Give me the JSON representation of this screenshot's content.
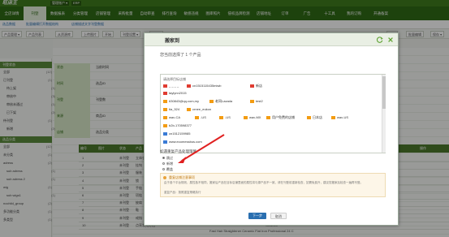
{
  "app": {
    "brand": "旺店王",
    "account": "管理账户 ▾",
    "erp": "ERP"
  },
  "nav": [
    "全店详情",
    "刊登",
    "数据报表",
    "分类管理",
    "店铺管理",
    "采购批量",
    "自动审查",
    "排行查询",
    "敏感违规",
    "图库照片",
    "侵权品牌检测",
    "店铺地址",
    "订单",
    "广告",
    "十工具",
    "我的订购",
    "开通备案"
  ],
  "subbar": [
    "选品数据",
    "批量编辑打开数据结构",
    "店铺描述文字刊登数据"
  ],
  "toolbar": [
    "产品管理 ▾",
    "产品列表",
    "从资源库",
    "上传图片",
    "开始",
    "刊登设置 ▾",
    "翻译 ▾",
    "配置",
    "批量编辑",
    "字段",
    "保存 ▾"
  ],
  "sidebar": {
    "sections": [
      {
        "label": "刊登状态",
        "count": "(1)",
        "items": [
          {
            "label": "全部",
            "count": "(12)"
          },
          {
            "label": "已刊登",
            "count": "(1)"
          },
          {
            "label": "待上架",
            "count": "(1)"
          },
          {
            "label": "审核中",
            "count": "(3)"
          },
          {
            "label": "审核未通过",
            "count": "(1)"
          },
          {
            "label": "已下架",
            "count": "(2)"
          },
          {
            "label": "待刊登",
            "count": "(1)"
          },
          {
            "label": "新增",
            "count": "(2)"
          }
        ]
      },
      {
        "label": "选品分类",
        "count": "(1)",
        "items": [
          {
            "label": "全部",
            "count": "(12)"
          },
          {
            "label": "未分类",
            "count": "(1)"
          },
          {
            "label": "adress",
            "count": "(2)"
          },
          {
            "label": "sub adress",
            "count": "(1)"
          },
          {
            "label": "sub adress 2",
            "count": "(1)"
          },
          {
            "label": "wig",
            "count": "(1)"
          },
          {
            "label": "sub wigs1",
            "count": "(1)"
          },
          {
            "label": "nochild_group",
            "count": "(2)"
          },
          {
            "label": "多功能分类",
            "count": "(1)"
          },
          {
            "label": "多类型",
            "count": "(1)"
          }
        ]
      }
    ]
  },
  "filter": {
    "left": [
      "状态",
      "时间",
      "刊登",
      "来源",
      "店铺",
      "品牌",
      "选购数量"
    ],
    "col1": [
      "当前时间",
      "选品ID",
      "刊登数",
      "商品ID",
      "选品分类",
      "刊登状态",
      "已刊登"
    ],
    "col2": [
      "选择ID",
      "选择SKU",
      "选择店铺",
      "选择产品",
      "选择分类",
      "选择状态",
      "选择刊登"
    ]
  },
  "table": {
    "headers": [
      "编号",
      "图片",
      "图像",
      "状态",
      "产品",
      "标题",
      "价格",
      "库存",
      "销量",
      "状态",
      "操作"
    ],
    "rows": [
      {
        "no": "1",
        "status": "未刊登",
        "title": "立体衣框",
        "sku": "SKU001"
      },
      {
        "no": "2",
        "status": "未刊登",
        "title": "挂钩",
        "sku": "SKU002"
      },
      {
        "no": "3",
        "status": "未刊登",
        "title": "服装",
        "sku": "SKU003"
      },
      {
        "no": "4",
        "status": "未刊登",
        "title": "锁",
        "sku": "SKU004"
      },
      {
        "no": "5",
        "status": "未刊登",
        "title": "手链",
        "sku": "SKU005"
      },
      {
        "no": "6",
        "status": "未刊登",
        "title": "项链",
        "sku": "SKU006"
      },
      {
        "no": "7",
        "status": "未刊登",
        "title": "披肩",
        "sku": "SKU007"
      },
      {
        "no": "8",
        "status": "未刊登",
        "title": "鞋",
        "sku": "SKU008"
      },
      {
        "no": "9",
        "status": "未刊登",
        "title": "戒指",
        "sku": "SKU009"
      },
      {
        "no": "10",
        "status": "未刊登",
        "title": "点亮发光灯泡",
        "sku": "SKU010"
      }
    ],
    "bottom_row_text": "Fast Hair Straightener Ceramic Flat Iron Professional 24 C"
  },
  "dialog": {
    "title": "搬家到",
    "selected_text": "您当前选择了 1 个产品",
    "stores_header": "请选择目标店铺",
    "stores": [
      {
        "label": "_ _ _ _",
        "color": "#e03c31"
      },
      {
        "label": "cn1515115435miwb",
        "color": "#e03c31"
      },
      {
        "label": "新店",
        "color": "#e03c31"
      },
      {
        "label": "taylynn2015",
        "color": "#e03c31"
      },
      {
        "label": "630843@qq.com,my",
        "color": "#f39c12"
      },
      {
        "label": "老同Lazada",
        "color": "#f39c12"
      },
      {
        "label": "test2",
        "color": "#f39c12"
      },
      {
        "label": "tia_524",
        "color": "#f39c12"
      },
      {
        "label": "crnee_eukon",
        "color": "#f39c12"
      },
      {
        "label": "wav-CA",
        "color": "#f39c12"
      },
      {
        "label": "-US",
        "color": "#f39c12"
      },
      {
        "label": "-US",
        "color": "#f39c12"
      },
      {
        "label": "wav-MX",
        "color": "#f39c12"
      },
      {
        "label": "用户免费的店铺",
        "color": "#f39c12"
      },
      {
        "label": "日本店",
        "color": "#f39c12"
      },
      {
        "label": "wav-US",
        "color": "#f39c12"
      },
      {
        "label": "b2b-170598377",
        "color": "#f39c12"
      },
      {
        "label": "cn1512159985",
        "color": "#3a7bd5"
      },
      {
        "label": "www.ecomessbus.com",
        "color": "#3a7bd5"
      }
    ],
    "strategy_label": "如遇重复产品处理策略",
    "options": [
      "跳过",
      "新增",
      "覆盖"
    ],
    "selected_option": "跳过",
    "notice_title": "重复店铺注意事项",
    "notice_text": "由于各个平台规则，属性各不相同，搬家后产品在目标店铺里面的属性将与源产品不一致，请在刊登前重新检查，如需免费升，建议您搬家后检查一遍再刊登。",
    "notice_text2": "重复产品：按照重复策略执行",
    "primary_button": "下一步",
    "cancel_button": "取消",
    "refresh_icon": "refresh-icon",
    "close_icon": "close-icon"
  },
  "colors": {
    "nav": "#2f6b16",
    "accent": "#4c7a2c",
    "arrow": "#e02020",
    "primary_btn": "#2a6fb0"
  }
}
